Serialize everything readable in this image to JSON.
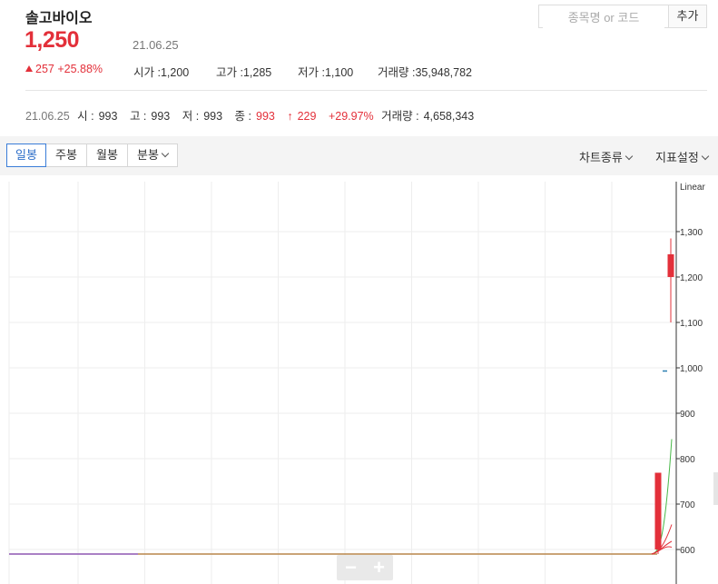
{
  "stock": {
    "name": "솔고바이오",
    "price": "1,250",
    "date": "21.06.25",
    "change": "257",
    "change_pct": "+25.88%",
    "open_label": "시가 :",
    "open": "1,200",
    "high_label": "고가 :",
    "high": "1,285",
    "low_label": "저가 :",
    "low": "1,100",
    "volume_label": "거래량 :",
    "volume": "35,948,782"
  },
  "search": {
    "placeholder": "종목명 or 코드",
    "add_label": "추가"
  },
  "prev": {
    "date": "21.06.25",
    "open_label": "시 :",
    "open": "993",
    "high_label": "고 :",
    "high": "993",
    "low_label": "저 :",
    "low": "993",
    "close_label": "종 :",
    "close": "993",
    "change_arrow": "↑",
    "change": "229",
    "change_pct": "+29.97%",
    "volume_label": "거래량 :",
    "volume": "4,658,343"
  },
  "toolbar": {
    "tabs": [
      "일봉",
      "주봉",
      "월봉",
      "분봉"
    ],
    "active_tab": "일봉",
    "chart_type_label": "차트종류",
    "indicator_label": "지표설정"
  },
  "colors": {
    "up": "#e3303a",
    "accent": "#3a7dd8",
    "ma_green": "#48b848",
    "ma_purple": "#9a6ad0",
    "ma_orange": "#b8864a"
  },
  "chart_data": {
    "type": "candlestick",
    "scale_label": "Linear",
    "y_ticks": [
      "1,300",
      "1,200",
      "1,100",
      "1,000",
      "900",
      "800",
      "700",
      "600"
    ],
    "ylim": [
      570,
      1330
    ],
    "candles": [
      {
        "open": 600,
        "close": 769,
        "high": 769,
        "low": 590
      },
      {
        "open": 1200,
        "close": 1250,
        "high": 1285,
        "low": 1100
      }
    ],
    "previous_close_marker": 993,
    "baseline": 590,
    "moving_averages": [
      {
        "color": "green",
        "end_value": 843
      },
      {
        "color": "red",
        "end_value": 655
      },
      {
        "color": "red",
        "end_value": 618
      },
      {
        "color": "red",
        "end_value": 605
      }
    ]
  },
  "zoom": {
    "minus": "−",
    "plus": "+"
  }
}
